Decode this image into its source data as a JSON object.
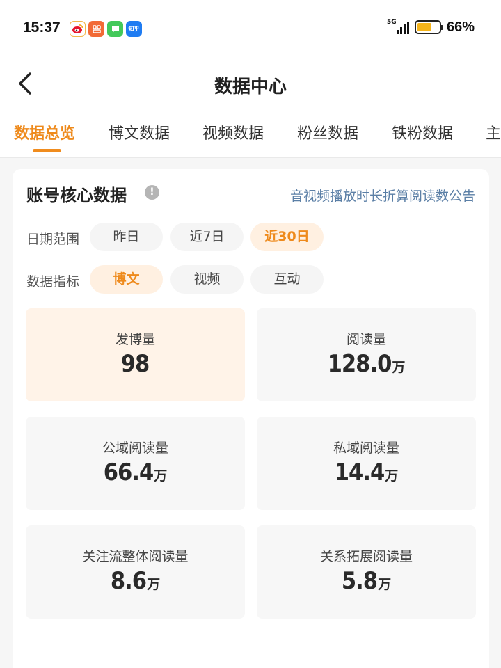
{
  "status_bar": {
    "time": "15:37",
    "apps": [
      {
        "icon": "weibo-icon"
      },
      {
        "icon": "xiaohongshu-icon"
      },
      {
        "icon": "messages-icon"
      },
      {
        "icon": "zhihu-icon",
        "label": "知乎"
      }
    ],
    "network": "5G",
    "battery_level": 0.66,
    "battery_text": "66%"
  },
  "nav": {
    "title": "数据中心",
    "back_icon": "chevron-left-icon"
  },
  "tabs": [
    {
      "label": "数据总览",
      "active": true
    },
    {
      "label": "博文数据"
    },
    {
      "label": "视频数据"
    },
    {
      "label": "粉丝数据"
    },
    {
      "label": "铁粉数据"
    },
    {
      "label": "主"
    }
  ],
  "card": {
    "title": "账号核心数据",
    "info_icon": "info-icon",
    "info_symbol": "!",
    "notice_link": "音视频播放时长折算阅读数公告",
    "date_range": {
      "label": "日期范围",
      "options": [
        "昨日",
        "近7日",
        "近30日"
      ],
      "selected": "近30日"
    },
    "metric": {
      "label": "数据指标",
      "options": [
        "博文",
        "视频",
        "互动"
      ],
      "selected": "博文"
    },
    "stats": [
      {
        "label": "发博量",
        "value": "98",
        "unit": "",
        "active": true
      },
      {
        "label": "阅读量",
        "value": "128.0",
        "unit": "万"
      },
      {
        "label": "公域阅读量",
        "value": "66.4",
        "unit": "万"
      },
      {
        "label": "私域阅读量",
        "value": "14.4",
        "unit": "万"
      },
      {
        "label": "关注流整体阅读量",
        "value": "8.6",
        "unit": "万"
      },
      {
        "label": "关系拓展阅读量",
        "value": "5.8",
        "unit": "万"
      }
    ]
  },
  "colors": {
    "accent": "#ee8a1c",
    "active_pill_bg": "#fff0e1",
    "active_stat_bg": "#fff3e8",
    "link": "#5b7fa6"
  }
}
